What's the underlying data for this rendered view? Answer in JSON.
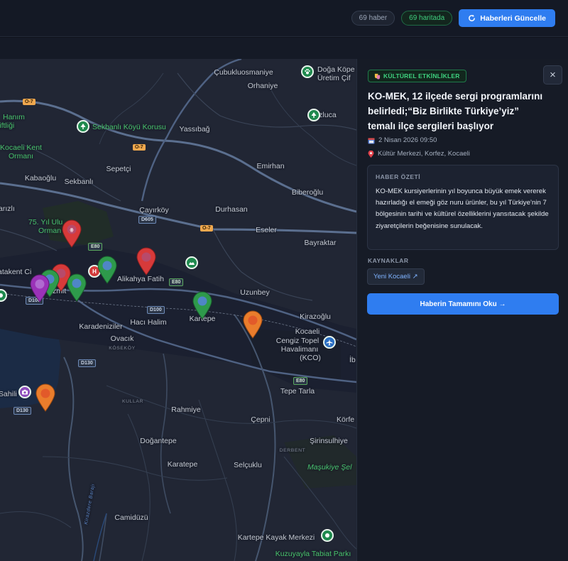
{
  "topbar": {
    "news_count": "69 haber",
    "map_count": "69 haritada",
    "refresh_label": "Haberleri Güncelle"
  },
  "map": {
    "labels": {
      "cubukluosmaniye": "Çubukluosmaniye",
      "doga_kopek": "Doğa Köpe",
      "uretim_ciftl": "Üretim Çif",
      "ohaniye": "Orhaniye",
      "hanim": "Hanım",
      "iftligi": "çiftliği",
      "kozluca": "Kozluca",
      "sekbanli_korusu": "Sekbanlı Köyü Korusu",
      "yassibag": "Yassıbağ",
      "kocaeli_kent": "Kocaeli Kent",
      "ormani": "Ormanı",
      "sepetci": "Sepetçi",
      "emirhan": "Emirhan",
      "kabaoglu": "Kabaoğlu",
      "sekbanli": "Sekbanlı",
      "biberoglu": "Biberoğlu",
      "arizli": "arızlı",
      "cayirkoy": "Çayırköy",
      "durhasan": "Durhasan",
      "yil_ulu": "75. Yıl Ulu",
      "orman": "Orman",
      "eseler": "Eseler",
      "bayraktar": "Bayraktar",
      "atakent": "atakent Ci",
      "alikahya": "Alikahya Fatih",
      "zmit": "zmit",
      "uzunbey": "Uzunbey",
      "kirazoglu": "Kirazoğlu",
      "karadeniziler": "Karadeniziler",
      "haci_halim": "Hacı Halim",
      "kartepe": "Kartepe",
      "ovacik": "Ovacık",
      "kosekoy": "KÖSEKÖY",
      "kocaeli": "Kocaeli",
      "cengiz_topel": "Cengiz Topel",
      "havalimani": "Havalimanı",
      "kco": "(KCO)",
      "sahili": "Sahili",
      "tepe_tarla": "Tepe Tarla",
      "kullar": "KULLAR",
      "rahmiye": "Rahmiye",
      "cepni": "Çepni",
      "korfe": "Körfe",
      "dogantepe": "Doğantepe",
      "sirinsulhiye": "Şirinsulhiye",
      "derbent": "DERBENT",
      "karatepe": "Karatepe",
      "selcuklu": "Selçuklu",
      "masukiye": "Maşukiye Şel",
      "kirazdere": "Kirazdere Barajı",
      "camiduzu": "Camidüzü",
      "kartepe_kayak": "Kartepe Kayak Merkezi",
      "kuzuyayla": "Kuzuyayla Tabiat Parkı",
      "ib": "İb"
    },
    "shields": {
      "o7_a": "O-7",
      "o7_b": "O-7",
      "o7_c": "O-7",
      "d605": "D605",
      "e80_a": "E80",
      "e80_b": "E80",
      "e80_c": "E80",
      "d100_a": "D100",
      "d100_b": "D100",
      "d130_a": "D130",
      "d130_b": "D130"
    }
  },
  "panel": {
    "category": "KÜLTÜREL ETKİNLİKLER",
    "title": "KO-MEK, 12 ilçede sergi programlarını belirledi;“Biz Birlikte Türkiye’yiz” temalı ilçe sergileri başlıyor",
    "date": "2 Nisan 2026 09:50",
    "location": "Kültür Merkezi, Korfez, Kocaeli",
    "summary_heading": "HABER ÖZETİ",
    "summary": "KO-MEK kursiyerlerinin yıl boyunca büyük emek vererek hazırladığı el emeği göz nuru ürünler, bu yıl Türkiye’nin 7 bölgesinin tarihi ve kültürel özelliklerini yansıtacak şekilde ziyaretçilerin beğenisine sunulacak.",
    "sources_heading": "KAYNAKLAR",
    "source_label": "Yeni Kocaeli ↗",
    "read_more_label": "Haberin Tamamını Oku →",
    "close_glyph": "×"
  },
  "colors": {
    "accent": "#2f7df0",
    "culture_green": "#3ed27f",
    "pin_red": "#d73a3a",
    "pin_green": "#2e9a4b",
    "pin_orange": "#ea7d2c",
    "pin_purple": "#9a32b8"
  }
}
